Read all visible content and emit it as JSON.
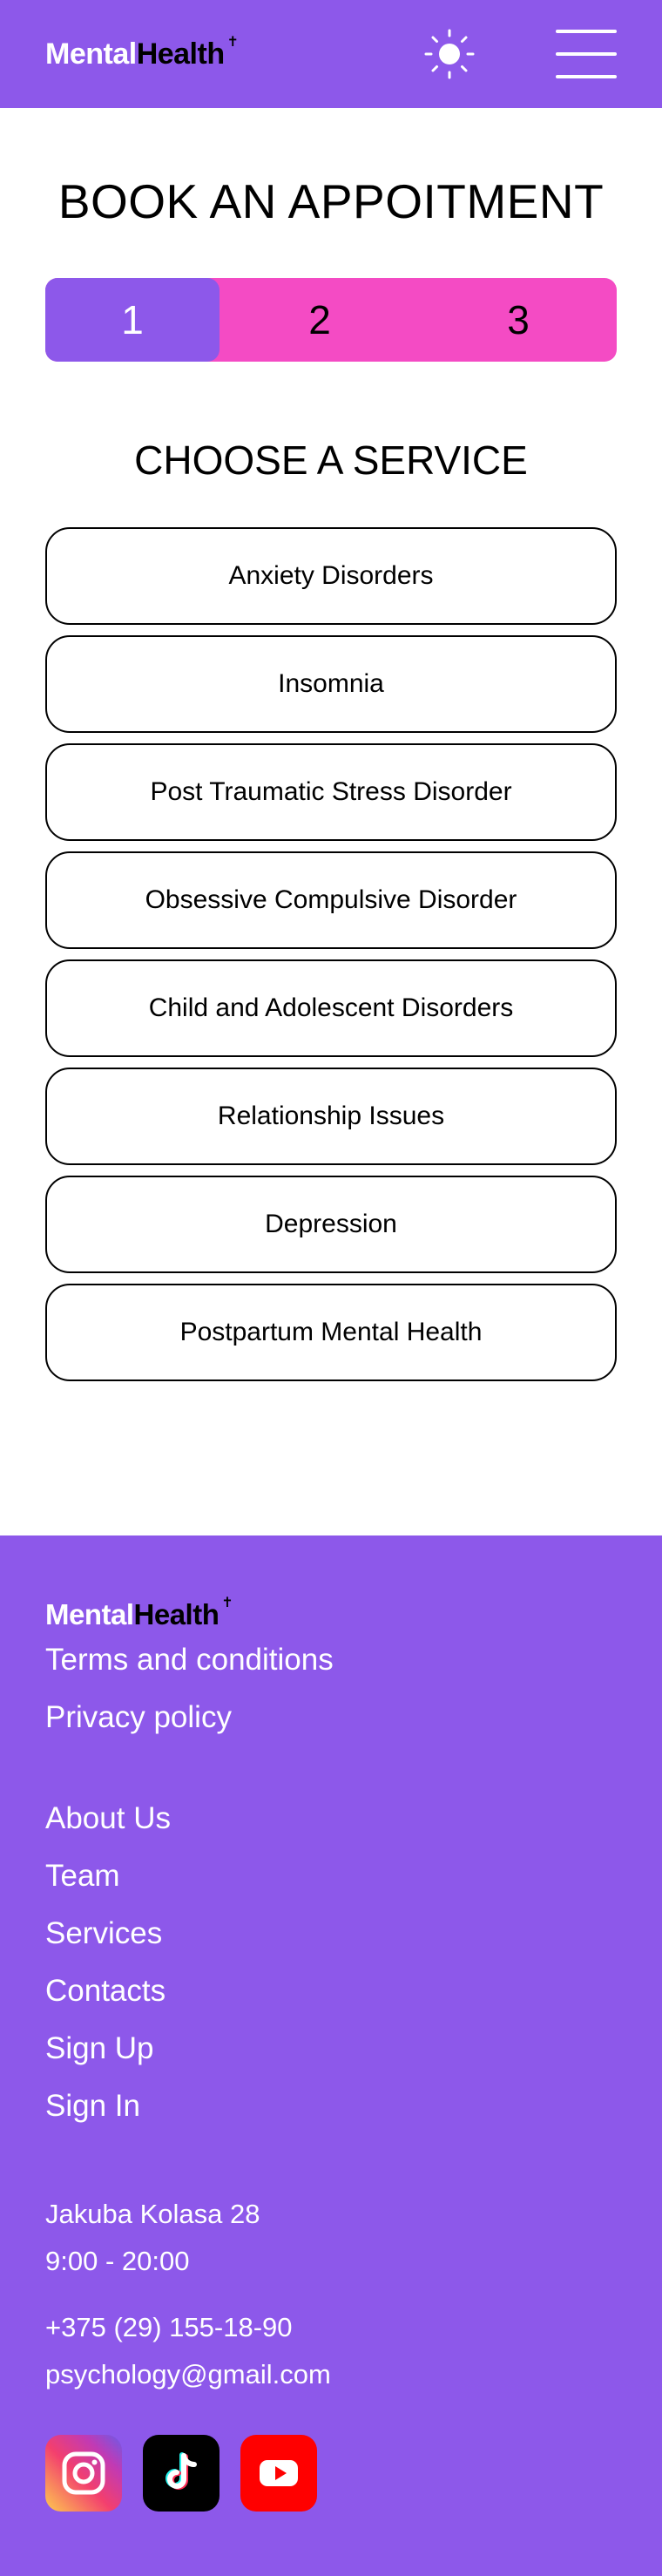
{
  "brand": {
    "part1": "Mental",
    "part2": "Health",
    "mark": "✝"
  },
  "header": {
    "theme_icon": "sun-icon",
    "menu_icon": "hamburger-menu-icon"
  },
  "page": {
    "title": "BOOK AN APPOITMENT"
  },
  "stepper": {
    "steps": [
      "1",
      "2",
      "3"
    ],
    "active": 1
  },
  "services": {
    "title": "CHOOSE A SERVICE",
    "items": [
      "Anxiety Disorders",
      "Insomnia",
      "Post Traumatic Stress Disorder",
      "Obsessive Compulsive Disorder",
      "Child and Adolescent Disorders",
      "Relationship Issues",
      "Depression",
      "Postpartum Mental Health"
    ]
  },
  "footer": {
    "legal": [
      "Terms and conditions",
      "Privacy policy"
    ],
    "nav": [
      "About Us",
      "Team",
      "Services",
      "Contacts",
      "Sign Up",
      "Sign In"
    ],
    "address": "Jakuba Kolasa 28",
    "hours": "9:00 - 20:00",
    "phone": "+375 (29) 155-18-90",
    "email": "psychology@gmail.com",
    "socials": [
      "instagram-icon",
      "tiktok-icon",
      "youtube-icon"
    ]
  },
  "colors": {
    "primary": "#8d58ea",
    "accent": "#f44bc4",
    "text": "#000000",
    "background": "#ffffff"
  }
}
